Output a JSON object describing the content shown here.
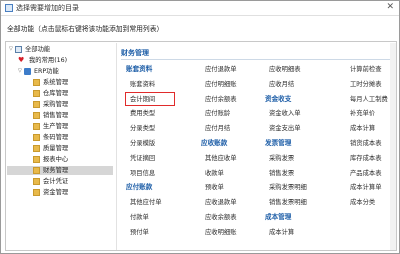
{
  "window": {
    "title": "选择需要增加的目录"
  },
  "hint": "全部功能（点击鼠标右键将该功能添加到常用列表）",
  "tree": {
    "root": "全部功能",
    "favorites": "我的常用(16)",
    "erp": "ERP功能",
    "modules": [
      "系统管理",
      "仓库管理",
      "采购管理",
      "销售管理",
      "生产管理",
      "条码管理",
      "质量管理",
      "报表中心",
      "财务管理",
      "会计凭证",
      "资金管理"
    ],
    "selected_index": 8
  },
  "section": {
    "title": "财务管理"
  },
  "columns": [
    [
      {
        "text": "账套资料",
        "group": true
      },
      {
        "text": "账套资料"
      },
      {
        "text": "会计期间",
        "highlight": true
      },
      {
        "text": "费用类型"
      },
      {
        "text": "分录类型"
      },
      {
        "text": "分录模版"
      },
      {
        "text": "凭证摘回"
      },
      {
        "text": "项目信息"
      },
      {
        "text": "应付账款",
        "group": true
      },
      {
        "text": "其他应付单"
      },
      {
        "text": "付款单"
      },
      {
        "text": "预付单"
      }
    ],
    [
      {
        "text": "应付退款单"
      },
      {
        "text": "应付明细账"
      },
      {
        "text": "应付余额表"
      },
      {
        "text": "应付账龄"
      },
      {
        "text": "应付月结"
      },
      {
        "text": "应收账款",
        "group": true
      },
      {
        "text": "其他应收单"
      },
      {
        "text": "收款单"
      },
      {
        "text": "预收单"
      },
      {
        "text": "应收退款单"
      },
      {
        "text": "应收余额表"
      },
      {
        "text": "应收明细账"
      }
    ],
    [
      {
        "text": "应收明细表"
      },
      {
        "text": "应收月结"
      },
      {
        "text": "资金收支",
        "group": true
      },
      {
        "text": "资金收入单"
      },
      {
        "text": "资金支出单"
      },
      {
        "text": "发票管理",
        "group": true
      },
      {
        "text": "采购发票"
      },
      {
        "text": "销售发票"
      },
      {
        "text": "采购发票明细"
      },
      {
        "text": "销售发票明细"
      },
      {
        "text": "成本管理",
        "group": true
      },
      {
        "text": "成本计算"
      }
    ],
    [
      {
        "text": "计算前检查"
      },
      {
        "text": "工时分摊表"
      },
      {
        "text": "每月人工制费"
      },
      {
        "text": "补充单价"
      },
      {
        "text": "成本计算"
      },
      {
        "text": "销货成本表"
      },
      {
        "text": "库存成本表"
      },
      {
        "text": "产品成本表"
      },
      {
        "text": "成本计算单"
      },
      {
        "text": "成本分类"
      }
    ]
  ]
}
